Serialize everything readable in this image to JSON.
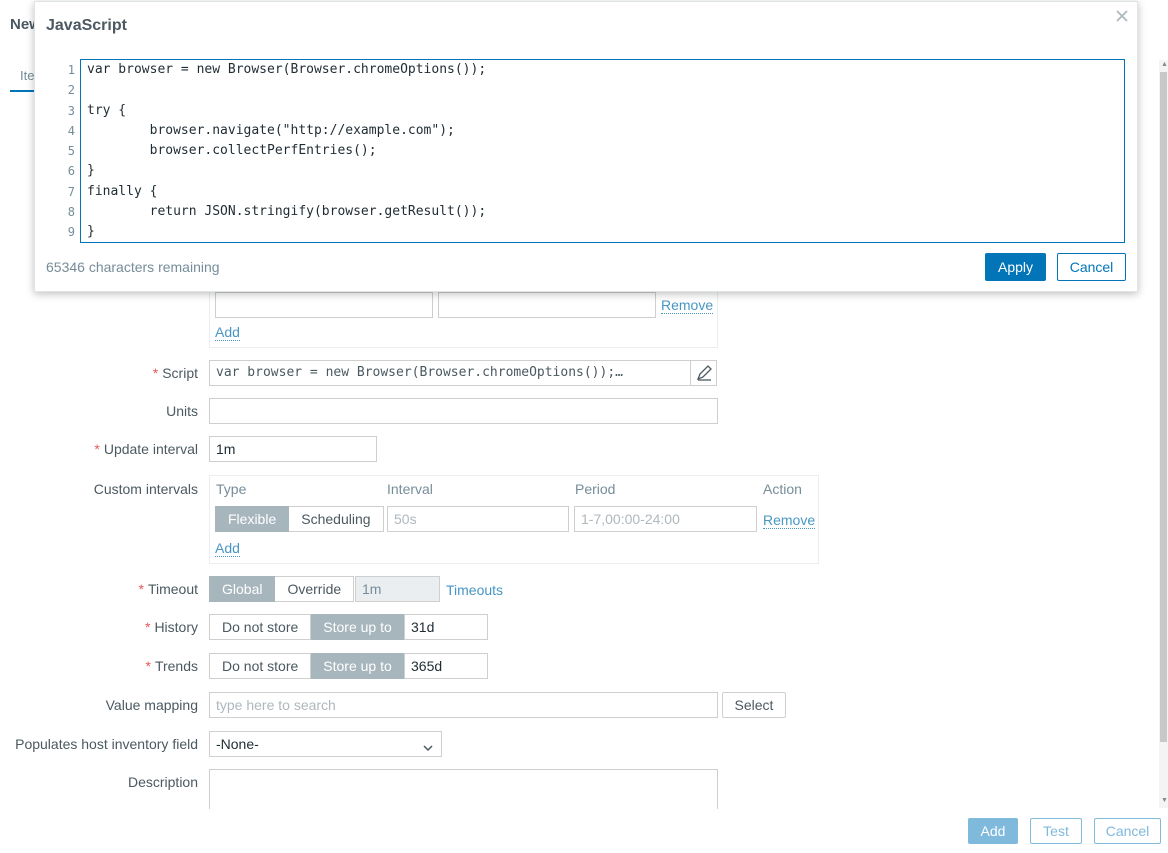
{
  "background": {
    "title": "New",
    "tab": "Ite",
    "headers_remove": "Remove",
    "headers_add": "Add",
    "script_label": "Script",
    "script_value": "var browser = new Browser(Browser.chromeOptions());…",
    "units_label": "Units",
    "update_interval_label": "Update interval",
    "update_interval_value": "1m",
    "custom_intervals": {
      "label": "Custom intervals",
      "col_type": "Type",
      "col_interval": "Interval",
      "col_period": "Period",
      "col_action": "Action",
      "flexible": "Flexible",
      "scheduling": "Scheduling",
      "interval_placeholder": "50s",
      "period_placeholder": "1-7,00:00-24:00",
      "remove": "Remove",
      "add": "Add"
    },
    "timeout": {
      "label": "Timeout",
      "global": "Global",
      "override": "Override",
      "value": "1m",
      "link": "Timeouts"
    },
    "history": {
      "label": "History",
      "do_not_store": "Do not store",
      "store_up_to": "Store up to",
      "value": "31d"
    },
    "trends": {
      "label": "Trends",
      "do_not_store": "Do not store",
      "store_up_to": "Store up to",
      "value": "365d"
    },
    "value_mapping": {
      "label": "Value mapping",
      "placeholder": "type here to search",
      "select": "Select"
    },
    "inventory": {
      "label": "Populates host inventory field",
      "value": "-None-"
    },
    "description_label": "Description",
    "footer": {
      "add": "Add",
      "test": "Test",
      "cancel": "Cancel"
    }
  },
  "dialog": {
    "title": "JavaScript",
    "line_numbers": [
      "1",
      "2",
      "3",
      "4",
      "5",
      "6",
      "7",
      "8",
      "9"
    ],
    "code_lines": [
      "var browser = new Browser(Browser.chromeOptions());",
      "",
      "try {",
      "        browser.navigate(\"http://example.com\");",
      "        browser.collectPerfEntries();",
      "}",
      "finally {",
      "        return JSON.stringify(browser.getResult());",
      "}"
    ],
    "remaining": "65346 characters remaining",
    "apply": "Apply",
    "cancel": "Cancel"
  },
  "colors": {
    "primary": "#0275b8",
    "required": "#e45959",
    "segment_active": "#a7b5bd",
    "link": "#4796c4"
  },
  "icons": {
    "close": "close-icon",
    "pencil": "pencil-icon",
    "chevron": "chevron-down-icon"
  }
}
